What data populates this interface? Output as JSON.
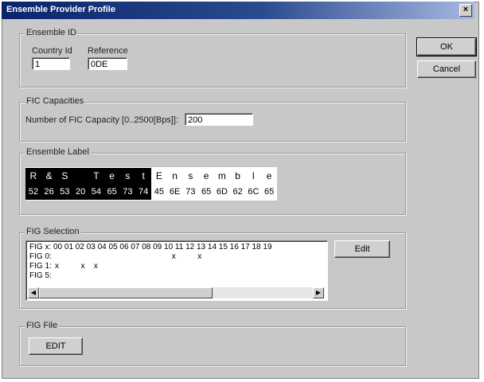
{
  "window": {
    "title": "Ensemble Provider Profile",
    "close_label": "×"
  },
  "buttons": {
    "ok": "OK",
    "cancel": "Cancel",
    "edit": "Edit",
    "edit_file": "EDIT"
  },
  "ensemble_id": {
    "group_label": "Ensemble ID",
    "country_label": "Country Id",
    "country_value": "1",
    "reference_label": "Reference",
    "reference_value": "0DE"
  },
  "fic": {
    "group_label": "FIC Capacities",
    "field_label": "Number of FIC Capacity [0..2500[Bps]]:",
    "field_value": "200"
  },
  "ensemble_label": {
    "group_label": "Ensemble Label",
    "chars": [
      "R",
      "&",
      "S",
      " ",
      "T",
      "e",
      "s",
      "t",
      "E",
      "n",
      "s",
      "e",
      "m",
      "b",
      "l",
      "e"
    ],
    "hex": [
      "52",
      "26",
      "53",
      "20",
      "54",
      "65",
      "73",
      "74",
      "45",
      "6E",
      "73",
      "65",
      "6D",
      "62",
      "6C",
      "65"
    ]
  },
  "fig_selection": {
    "group_label": "FIG Selection",
    "header": "FIG x: 00 01 02 03 04 05 06 07 08 09 10 11 12 13 14 15 16 17 18 19",
    "rows": [
      {
        "label": "FIG 0:",
        "marks": [
          9,
          11
        ]
      },
      {
        "label": "FIG 1:",
        "marks": [
          0,
          2,
          3
        ]
      },
      {
        "label": "FIG 5:",
        "marks": []
      }
    ],
    "mark_char": "x"
  },
  "fig_file": {
    "group_label": "FIG File"
  },
  "icons": {
    "scroll_left": "left-arrow-icon",
    "scroll_right": "right-arrow-icon"
  }
}
